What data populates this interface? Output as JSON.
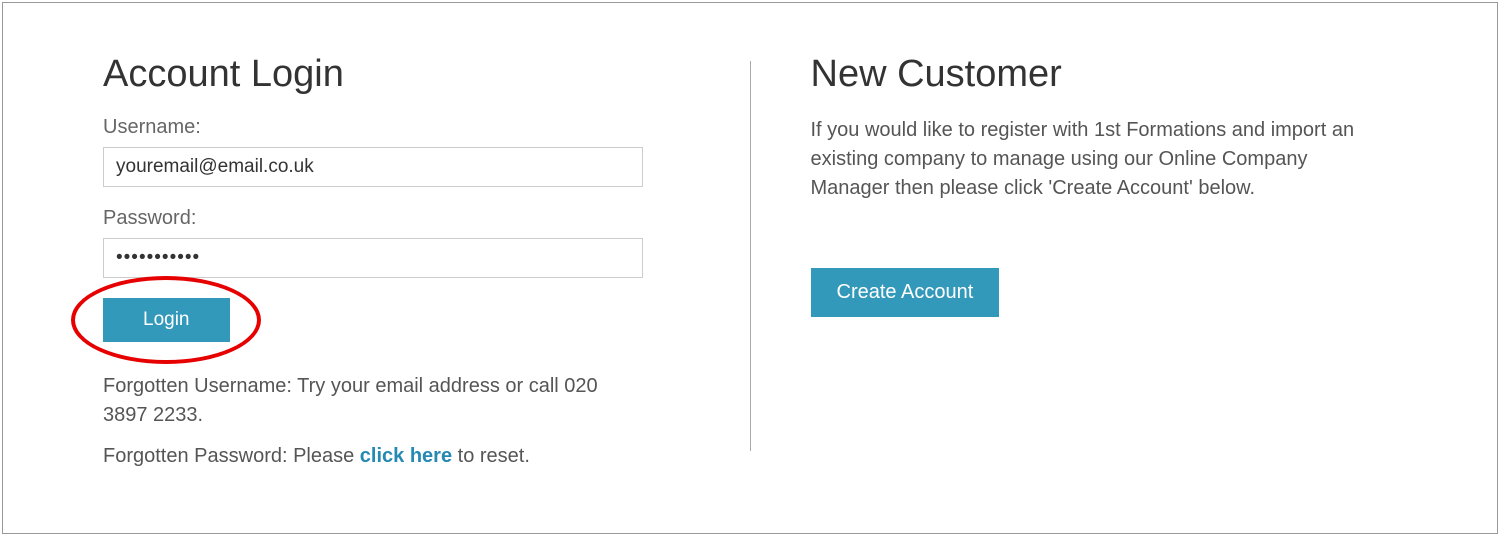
{
  "login": {
    "heading": "Account Login",
    "username_label": "Username:",
    "username_value": "youremail@email.co.uk",
    "password_label": "Password:",
    "password_value": "•••••••••••",
    "login_button": "Login",
    "forgot_username_text": "Forgotten Username: Try your email address or call 020 3897 2233.",
    "forgot_password_prefix": "Forgotten Password: Please ",
    "forgot_password_link": "click here",
    "forgot_password_suffix": " to reset."
  },
  "new_customer": {
    "heading": "New Customer",
    "description": "If you would like to register with 1st Formations and import an existing company to manage using our Online Company Manager then please click 'Create Account' below.",
    "create_button": "Create Account"
  }
}
